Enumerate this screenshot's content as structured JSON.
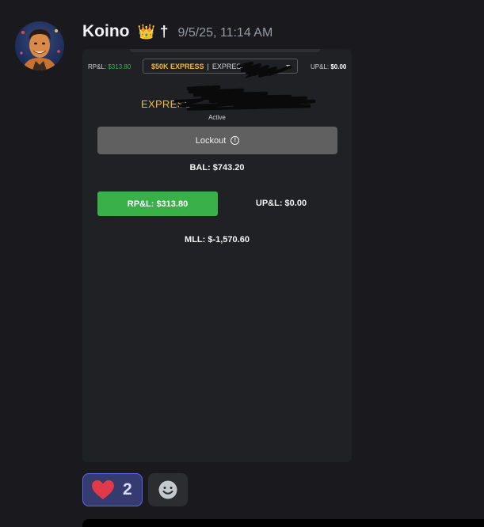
{
  "message": {
    "username": "Koino",
    "badge_crown": "👑",
    "badge_dagger": "†",
    "timestamp": "9/5/25, 11:14 AM"
  },
  "embed": {
    "topbar": {
      "rpl_label": "RP&L:",
      "rpl_value": "$313.80",
      "account_plan": "$50K EXPRESS",
      "account_separator": "|",
      "account_name": "EXPRESS",
      "upl_label": "UP&L:",
      "upl_value": "$0.00"
    },
    "account_title": "EXPRESS-",
    "status": "Active",
    "lockout_label": "Lockout",
    "lockout_icon": "info-icon",
    "balance": "BAL: $743.20",
    "rpl_button": "RP&L: $313.80",
    "upl_text": "UP&L: $0.00",
    "mll_text": "MLL: $-1,570.60"
  },
  "reactions": [
    {
      "emoji_icon": "heart-icon",
      "count": "2"
    }
  ],
  "add_reaction_icon": "smiley-icon",
  "colors": {
    "background": "#1a1a1e",
    "embed_bg": "#202125",
    "gold": "#f5b82e",
    "green": "#3ab049",
    "reaction_border": "#5865f2",
    "lockout_gray": "#606060"
  }
}
